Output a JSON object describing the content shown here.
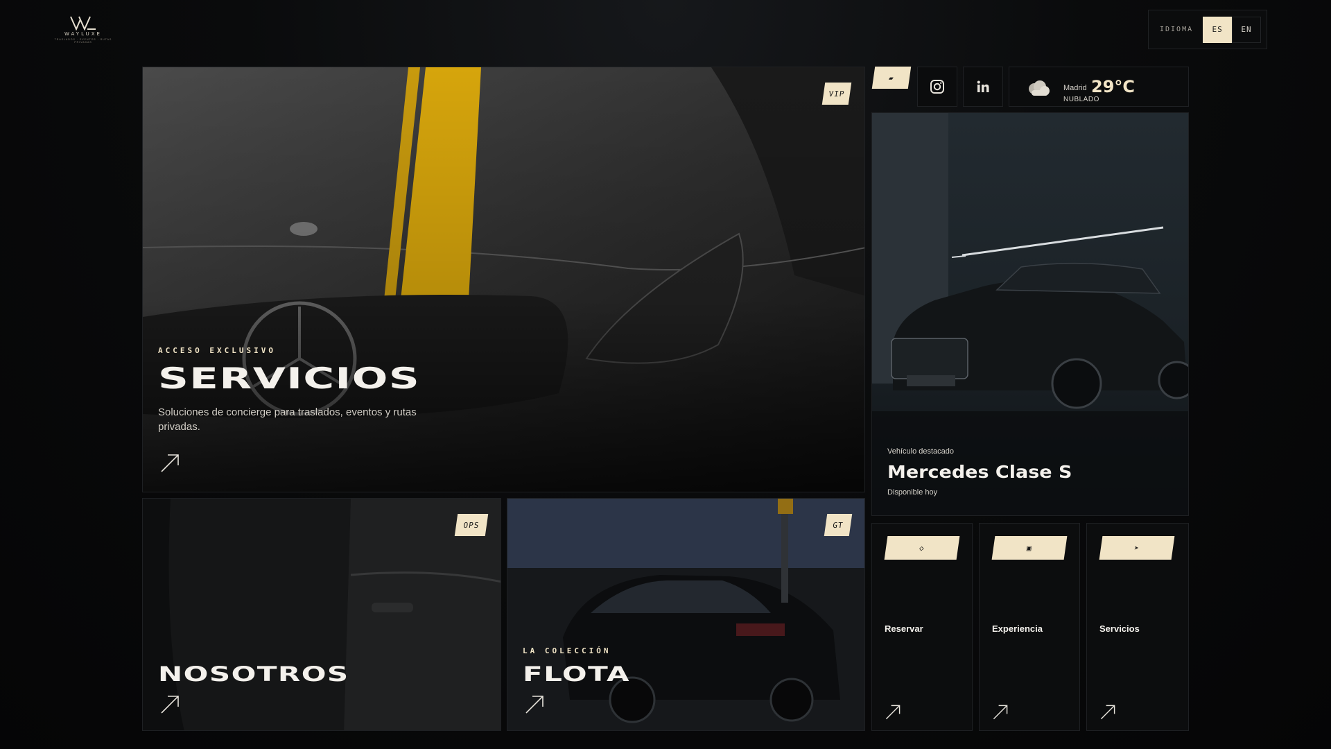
{
  "brand": {
    "name": "WAYLUXE",
    "tagline": "TRASLADOS · EVENTOS · RUTAS PRIVADAS"
  },
  "language": {
    "label": "IDIOMA",
    "options": [
      "ES",
      "EN"
    ],
    "selected": "ES"
  },
  "hero": {
    "tag": "VIP",
    "eyebrow": "ACCESO EXCLUSIVO",
    "title": "SERVICIOS",
    "description": "Soluciones de concierge para traslados, eventos y rutas privadas.",
    "accent_color": "#c89a0e"
  },
  "social": {
    "badge_glyph": "▰",
    "items": [
      "instagram-icon",
      "linkedin-icon"
    ]
  },
  "weather": {
    "city": "Madrid",
    "temperature": "29°C",
    "condition": "NUBLADO",
    "icon": "cloud-icon"
  },
  "featured": {
    "label": "Vehículo destacado",
    "title": "Mercedes Clase S",
    "availability": "Disponible hoy"
  },
  "about": {
    "tag": "OPS",
    "title": "NOSOTROS"
  },
  "fleet": {
    "tag": "GT",
    "eyebrow": "LA COLECCIÓN",
    "title": "FLOTA"
  },
  "quick_links": [
    {
      "glyph": "◇",
      "label": "Reservar"
    },
    {
      "glyph": "▣",
      "label": "Experiencia"
    },
    {
      "glyph": "➤",
      "label": "Servicios"
    }
  ],
  "colors": {
    "cream": "#f1e4c6",
    "background": "#0a0b0c",
    "border": "#1e2023"
  }
}
